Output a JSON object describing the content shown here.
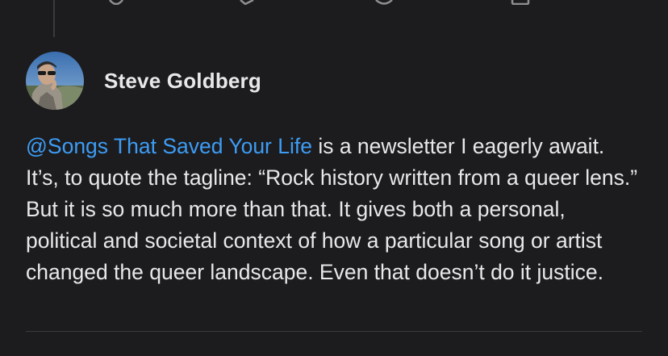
{
  "author": {
    "name": "Steve Goldberg",
    "avatar_icon": "profile-photo"
  },
  "post": {
    "mention": "@Songs That Saved Your Life",
    "text": " is a newsletter I eagerly await. It’s, to quote the tagline: “Rock history written from a queer lens.” But it is so much more than that. It gives both a personal, political and societal context of how a particular song or artist changed the queer landscape. Even that doesn’t do it justice."
  },
  "actions": {
    "icons": [
      "like-icon",
      "comment-icon",
      "restack-icon",
      "share-icon"
    ]
  },
  "colors": {
    "background": "#1c1c1e",
    "text": "#e8e8ea",
    "mention": "#3d9cf5",
    "divider": "#3a3a3c"
  }
}
